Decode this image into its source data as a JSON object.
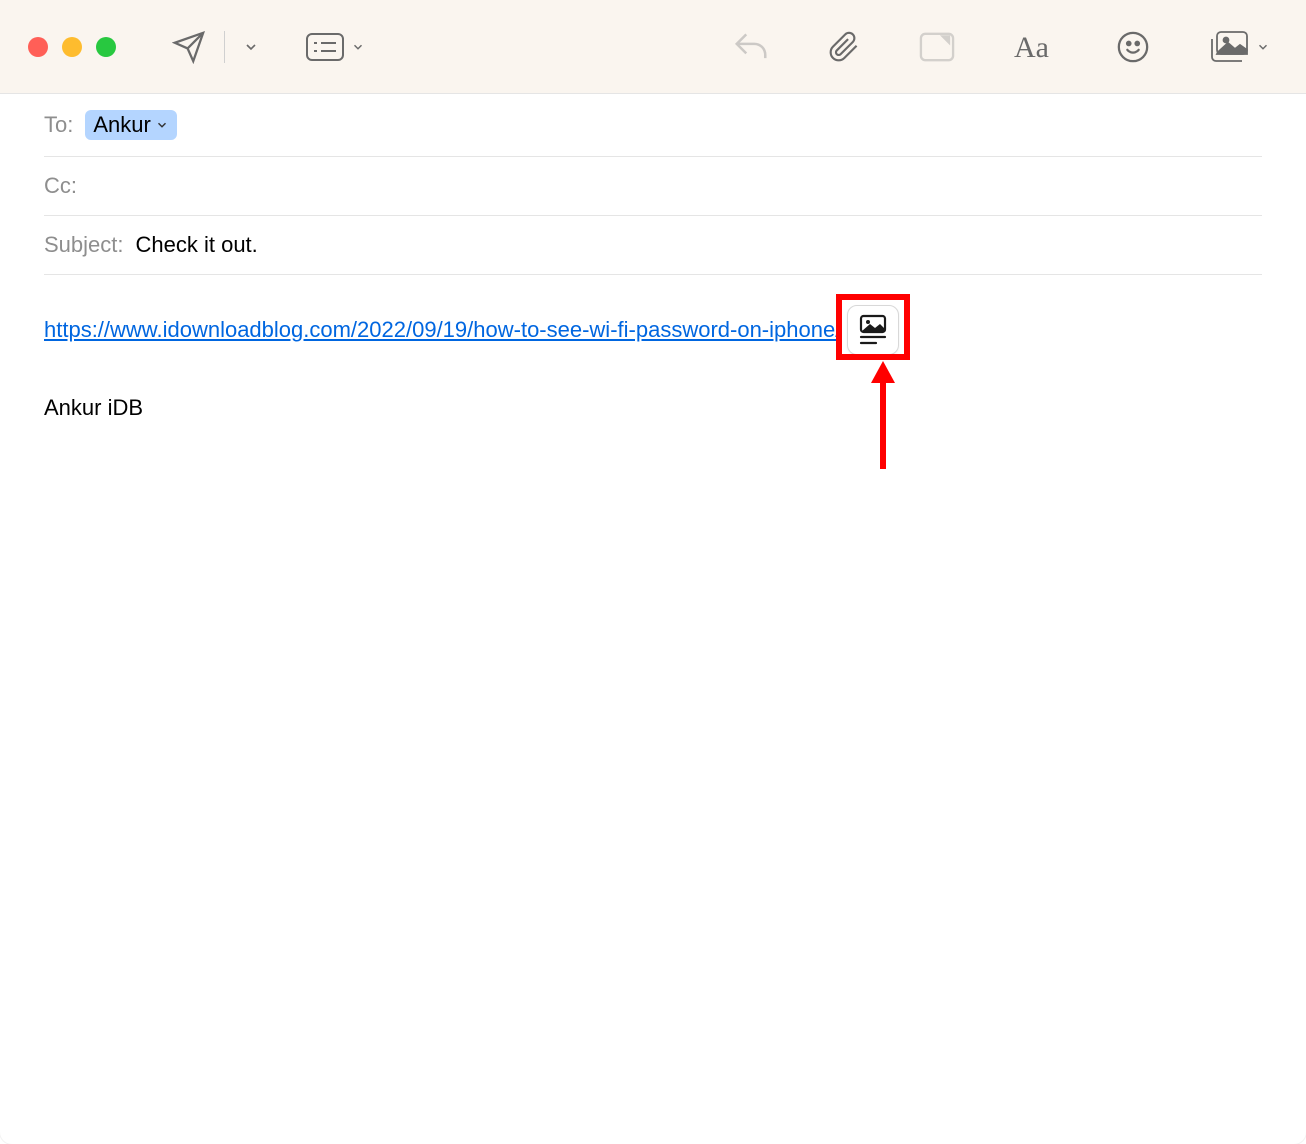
{
  "fields": {
    "to_label": "To:",
    "to_recipient": "Ankur",
    "cc_label": "Cc:",
    "subject_label": "Subject:",
    "subject_value": "Check it out."
  },
  "body": {
    "url": "https://www.idownloadblog.com/2022/09/19/how-to-see-wi-fi-password-on-iphone/",
    "signature": "Ankur iDB"
  }
}
